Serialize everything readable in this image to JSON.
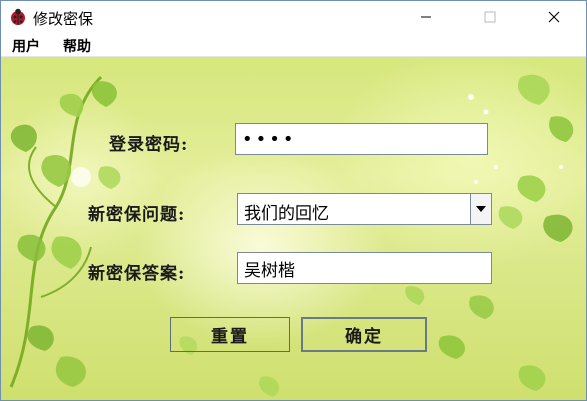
{
  "window": {
    "title": "修改密保",
    "icon": "ladybug-app-icon",
    "controls": [
      "minimize-icon",
      "maximize-icon",
      "close-icon"
    ]
  },
  "menu": {
    "items": [
      {
        "label": "用户"
      },
      {
        "label": "帮助"
      }
    ]
  },
  "form": {
    "password_label": "登录密码:",
    "password_value": "••••",
    "question_label": "新密保问题:",
    "question_selected": "我们的回忆",
    "answer_label": "新密保答案:",
    "answer_value": "吴树楷"
  },
  "buttons": {
    "reset_label": "重置",
    "confirm_label": "确定"
  },
  "colors": {
    "background_green": "#d6e77c",
    "leaf_green": "#8fc23a",
    "button_border": "#5f6b73"
  }
}
